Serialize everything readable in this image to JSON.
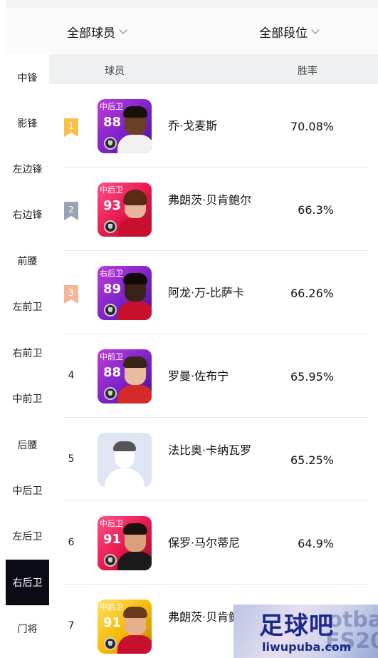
{
  "filters": {
    "players": "全部球员",
    "tiers": "全部段位"
  },
  "sidebar": {
    "items": [
      "中锋",
      "影锋",
      "左边锋",
      "右边锋",
      "前腰",
      "左前卫",
      "右前卫",
      "中前卫",
      "后腰",
      "中后卫",
      "左后卫",
      "右后卫",
      "门将"
    ],
    "active": "右后卫"
  },
  "table": {
    "col_player": "球员",
    "col_winrate": "胜率"
  },
  "rows": [
    {
      "rank": "1",
      "position": "中后卫",
      "rating": "88",
      "name": "乔·戈麦斯",
      "winrate": "70.08%",
      "card_color": "purple"
    },
    {
      "rank": "2",
      "position": "中后卫",
      "rating": "93",
      "name": "弗朗茨·贝肯鲍尔",
      "winrate": "66.3%",
      "card_color": "red"
    },
    {
      "rank": "3",
      "position": "右后卫",
      "rating": "89",
      "name": "阿龙·万-比萨卡",
      "winrate": "66.26%",
      "card_color": "purple"
    },
    {
      "rank": "4",
      "position": "中前卫",
      "rating": "88",
      "name": "罗曼·佐布宁",
      "winrate": "65.95%",
      "card_color": "purple"
    },
    {
      "rank": "5",
      "position": "",
      "rating": "",
      "name": "法比奥·卡纳瓦罗",
      "winrate": "65.25%",
      "card_color": "blank"
    },
    {
      "rank": "6",
      "position": "中后卫",
      "rating": "91",
      "name": "保罗·马尔蒂尼",
      "winrate": "64.9%",
      "card_color": "red"
    },
    {
      "rank": "7",
      "position": "中后卫",
      "rating": "91",
      "name": "弗朗茨·贝肯鲍尔",
      "winrate": "",
      "card_color": "gold"
    }
  ],
  "badge_colors": {
    "rank1": "#f7c04a",
    "rank2": "#9aa3b5",
    "rank3": "#f2b79b"
  },
  "watermark": {
    "title": "足球吧",
    "url": "liwupuba.com",
    "bg_text_1": "otba",
    "bg_text_2": "ES20"
  }
}
